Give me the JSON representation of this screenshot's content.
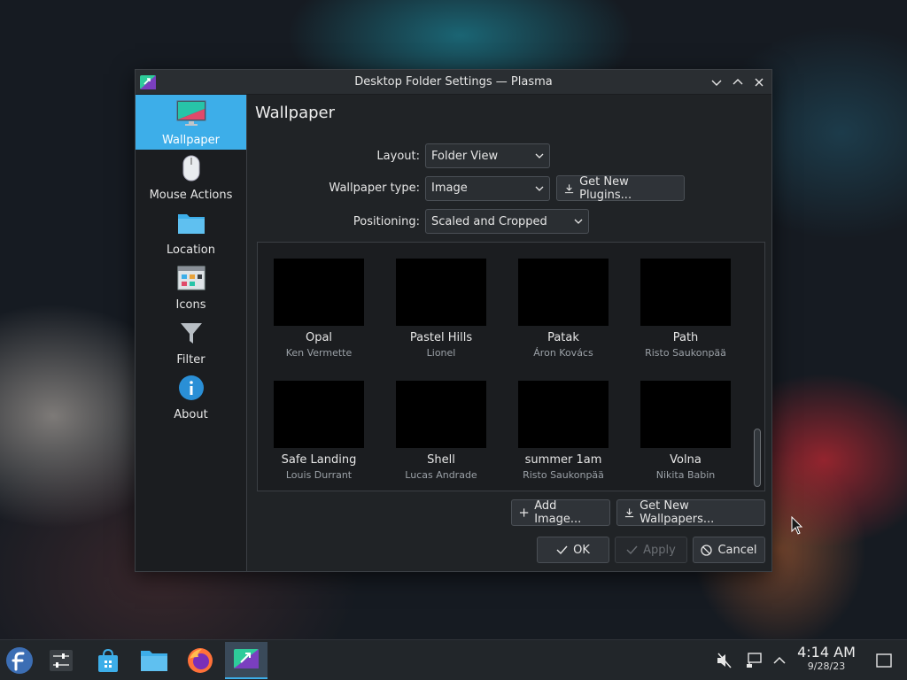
{
  "window": {
    "title": "Desktop Folder Settings — Plasma"
  },
  "sidebar": {
    "items": [
      {
        "label": "Wallpaper",
        "icon": "monitor-icon",
        "active": true
      },
      {
        "label": "Mouse Actions",
        "icon": "mouse-icon"
      },
      {
        "label": "Location",
        "icon": "folder-icon"
      },
      {
        "label": "Icons",
        "icon": "icons-grid-icon"
      },
      {
        "label": "Filter",
        "icon": "funnel-icon"
      },
      {
        "label": "About",
        "icon": "info-icon"
      }
    ]
  },
  "main": {
    "title": "Wallpaper",
    "layout": {
      "label": "Layout:",
      "value": "Folder View"
    },
    "wallpaper_type": {
      "label": "Wallpaper type:",
      "value": "Image"
    },
    "get_plugins_label": "Get New Plugins...",
    "positioning": {
      "label": "Positioning:",
      "value": "Scaled and Cropped"
    },
    "wallpapers": [
      {
        "name": "Opal",
        "author": "Ken Vermette"
      },
      {
        "name": "Pastel Hills",
        "author": "Lionel"
      },
      {
        "name": "Patak",
        "author": "Áron Kovács"
      },
      {
        "name": "Path",
        "author": "Risto Saukonpää"
      },
      {
        "name": "Safe Landing",
        "author": "Louis Durrant"
      },
      {
        "name": "Shell",
        "author": "Lucas Andrade"
      },
      {
        "name": "summer 1am",
        "author": "Risto Saukonpää"
      },
      {
        "name": "Volna",
        "author": "Nikita Babin"
      }
    ],
    "add_image_label": "Add Image...",
    "get_wallpapers_label": "Get New Wallpapers..."
  },
  "dialog_buttons": {
    "ok": "OK",
    "apply": "Apply",
    "cancel": "Cancel"
  },
  "taskbar": {
    "time": "4:14 AM",
    "date": "9/28/23"
  },
  "colors": {
    "accent": "#3daee9",
    "window_bg": "#202326",
    "sidebar_bg": "#1b1d20"
  }
}
